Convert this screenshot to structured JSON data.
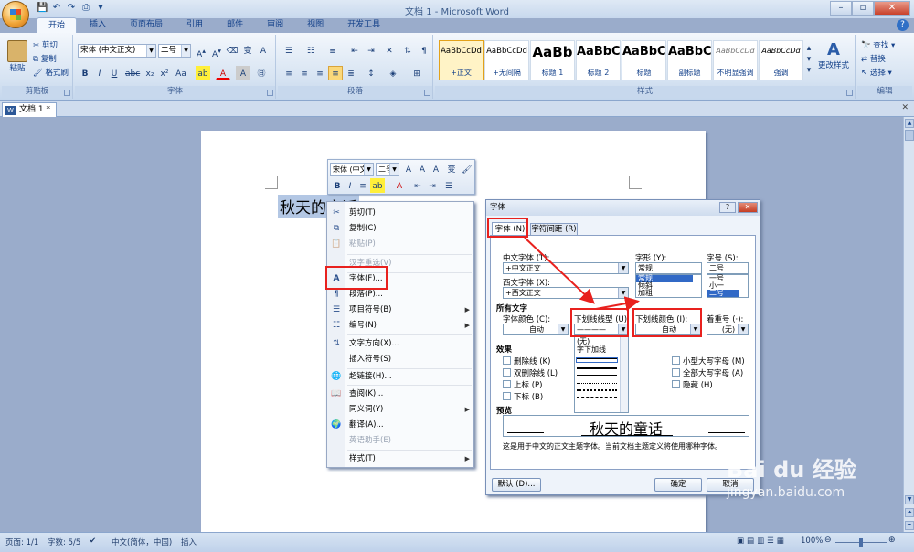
{
  "window": {
    "title": "文档 1 - Microsoft Word",
    "min": "–",
    "max": "▫",
    "close": "✕"
  },
  "ribbon": {
    "tabs": [
      "开始",
      "插入",
      "页面布局",
      "引用",
      "邮件",
      "审阅",
      "视图",
      "开发工具"
    ],
    "clipboard": {
      "paste": "粘贴",
      "cut": "剪切",
      "copy": "复制",
      "format_painter": "格式刷",
      "label": "剪贴板"
    },
    "font": {
      "name": "宋体 (中文正文)",
      "size": "二号",
      "label": "字体"
    },
    "paragraph": {
      "label": "段落"
    },
    "styles": {
      "label": "样式",
      "items": [
        {
          "sample": "AaBbCcDd",
          "name": "+正文"
        },
        {
          "sample": "AaBbCcDd",
          "name": "+无间隔"
        },
        {
          "sample": "AaBb",
          "name": "标题 1"
        },
        {
          "sample": "AaBbC",
          "name": "标题 2"
        },
        {
          "sample": "AaBbC",
          "name": "标题"
        },
        {
          "sample": "AaBbC",
          "name": "副标题"
        },
        {
          "sample": "AaBbCcDd",
          "name": "不明显强调"
        },
        {
          "sample": "AaBbCcDd",
          "name": "强调"
        }
      ],
      "change": "更改样式"
    },
    "editing": {
      "find": "查找",
      "replace": "替换",
      "select": "选择",
      "label": "编辑"
    }
  },
  "doc": {
    "tab": "文档 1 *",
    "text": "秋天的童话"
  },
  "minitoolbar": {
    "font": "宋体 (中文",
    "size": "二号"
  },
  "context_menu": [
    {
      "label": "剪切(T)",
      "icon": "✂",
      "disabled": false
    },
    {
      "label": "复制(C)",
      "icon": "⧉",
      "disabled": false
    },
    {
      "label": "粘贴(P)",
      "icon": "📋",
      "disabled": true
    },
    {
      "label": "汉字重选(V)",
      "icon": "",
      "disabled": true
    },
    {
      "label": "字体(F)...",
      "icon": "A",
      "disabled": false
    },
    {
      "label": "段落(P)...",
      "icon": "¶",
      "disabled": false
    },
    {
      "label": "项目符号(B)",
      "icon": "☰",
      "disabled": false,
      "sub": true
    },
    {
      "label": "编号(N)",
      "icon": "☷",
      "disabled": false,
      "sub": true
    },
    {
      "label": "文字方向(X)...",
      "icon": "⇅",
      "disabled": false
    },
    {
      "label": "插入符号(S)",
      "icon": "",
      "disabled": false
    },
    {
      "label": "超链接(H)...",
      "icon": "🌐",
      "disabled": false
    },
    {
      "label": "查阅(K)...",
      "icon": "📖",
      "disabled": false
    },
    {
      "label": "同义词(Y)",
      "icon": "",
      "disabled": false,
      "sub": true
    },
    {
      "label": "翻译(A)...",
      "icon": "🌍",
      "disabled": false
    },
    {
      "label": "英语助手(E)",
      "icon": "",
      "disabled": true
    },
    {
      "label": "样式(T)",
      "icon": "",
      "disabled": false,
      "sub": true
    }
  ],
  "dialog": {
    "title": "字体",
    "tab_font": "字体 (N)",
    "tab_spacing": "字符间距 (R)",
    "cn_font_label": "中文字体 (T):",
    "cn_font": "+中文正文",
    "west_font_label": "西文字体 (X):",
    "west_font": "+西文正文",
    "style_label": "字形 (Y):",
    "style_value": "常规",
    "style_list": [
      "常规",
      "倾斜",
      "加粗"
    ],
    "size_label": "字号 (S):",
    "size_value": "二号",
    "size_list": [
      "一号",
      "小一",
      "二号"
    ],
    "all_text": "所有文字",
    "font_color_label": "字体颜色 (C):",
    "font_color": "自动",
    "underline_label": "下划线线型 (U):",
    "underline_value": "————",
    "underline_list": [
      "(无)",
      "字下加线"
    ],
    "ucolor_label": "下划线颜色 (I):",
    "ucolor": "自动",
    "emphasis_label": "着重号 (·):",
    "emphasis": "(无)",
    "effects": "效果",
    "fx_left": [
      "删除线 (K)",
      "双删除线 (L)",
      "上标 (P)",
      "下标 (B)"
    ],
    "fx_right": [
      "小型大写字母 (M)",
      "全部大写字母 (A)",
      "隐藏 (H)"
    ],
    "preview_label": "预览",
    "preview_text": "秋天的童话",
    "note": "这是用于中文的正文主题字体。当前文档主题定义将使用哪种字体。",
    "default_btn": "默认 (D)...",
    "ok_btn": "确定",
    "cancel_btn": "取消"
  },
  "status": {
    "page": "页面: 1/1",
    "words": "字数: 5/5",
    "lang": "中文(简体，中国)",
    "mode": "插入",
    "zoom": "100%"
  },
  "watermark": {
    "brand": "Bai du 经验",
    "url": "jingyan.baidu.com"
  }
}
